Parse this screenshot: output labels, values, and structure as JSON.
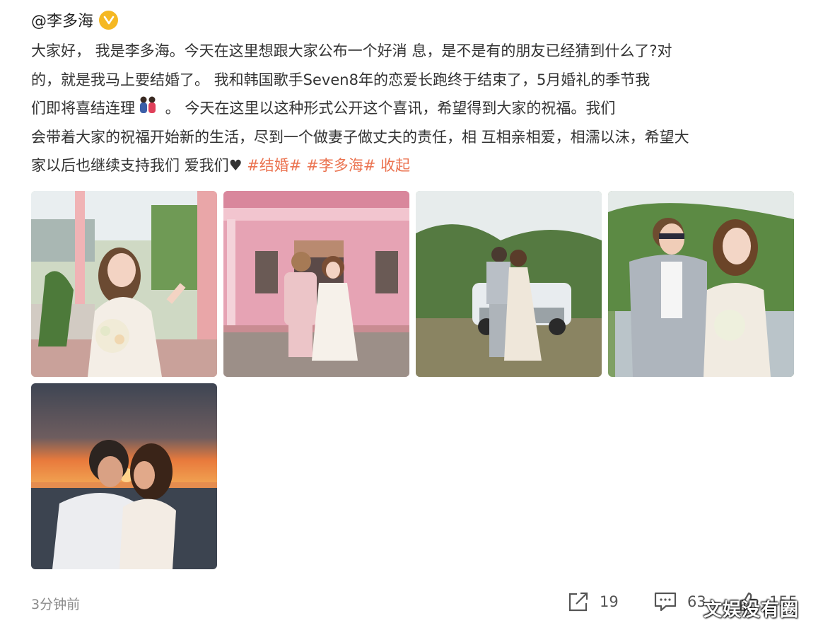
{
  "post": {
    "username": "@李多海",
    "verified_icon": "verified-badge-icon",
    "text_lines": [
      "大家好， 我是李多海。今天在这里想跟大家公布一个好消 息，是不是有的朋友已经猜到什么了?对",
      "的，就是我马上要结婚了。 我和韩国歌手Seven8年的恋爱长跑终于结束了，5月婚礼的季节我",
      "们即将喜结连理",
      " 。 今天在这里以这种形式公开这个喜讯，希望得到大家的祝福。我们",
      "会带着大家的祝福开始新的生活，尽到一个做妻子做丈夫的责任，相 互相亲相爱，相濡以沫，希望大",
      "家以后也继续支持我们 爱我们"
    ],
    "tags": [
      "#结婚#",
      "#李多海#"
    ],
    "collapse_label": "收起",
    "images": [
      {
        "name": "bride-porch-photo"
      },
      {
        "name": "couple-pink-house-photo"
      },
      {
        "name": "couple-vintage-car-photo"
      },
      {
        "name": "couple-closeup-photo"
      },
      {
        "name": "couple-sunset-kiss-photo"
      }
    ]
  },
  "footer": {
    "time": "3分钟前",
    "share_count": "19",
    "comment_count": "63",
    "like_count": "155",
    "share_icon": "share-icon",
    "comment_icon": "comment-icon",
    "like_icon": "like-icon"
  },
  "watermark": "文娱没有圈",
  "colors": {
    "accent": "#eb7350",
    "verified": "#f5b823",
    "text": "#333333",
    "muted": "#8a8a8a"
  }
}
